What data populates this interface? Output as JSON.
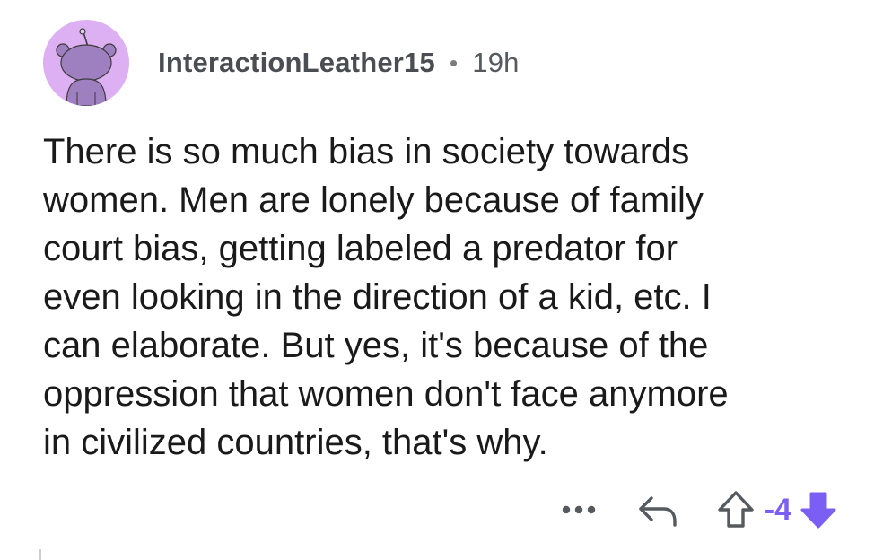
{
  "comment": {
    "username": "InteractionLeather15",
    "separator": "•",
    "time": "19h",
    "body": "There is so much bias in society towards\nwomen. Men are lonely because of family\ncourt bias, getting labeled a predator for\neven looking in the direction of a kid, etc. I\ncan elaborate. But yes, it's because of the\noppression that women don't face anymore\nin civilized countries, that's why.",
    "score": "-4",
    "vote_state": "downvoted"
  },
  "icons": {
    "avatar": "snoo-avatar-icon",
    "more": "more-options-icon",
    "reply": "reply-icon",
    "upvote": "upvote-arrow-icon",
    "downvote": "downvote-arrow-icon"
  },
  "colors": {
    "avatar_bg": "#dcb0f2",
    "avatar_figure": "#9e7fc0",
    "vote_accent": "#7b5ff5",
    "meta_text": "#555a5e",
    "body_text": "#1a1a1b"
  }
}
